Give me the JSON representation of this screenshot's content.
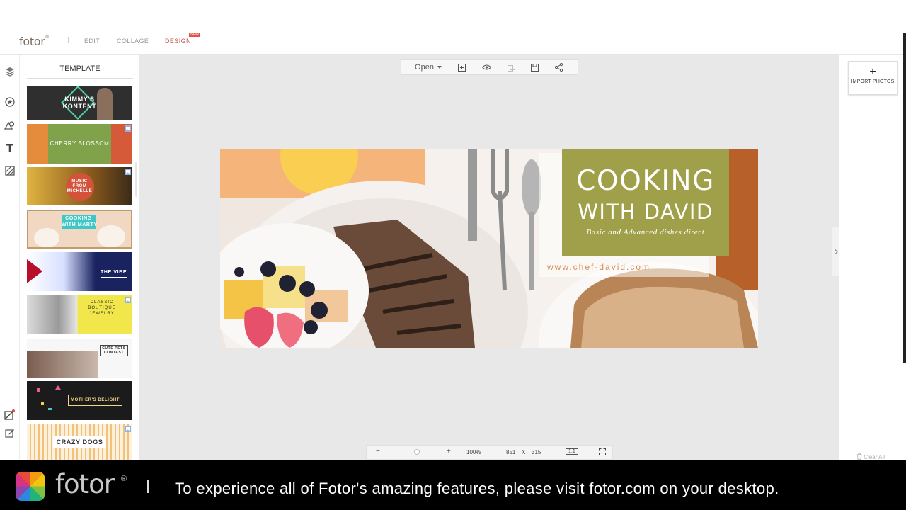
{
  "header": {
    "logo": "fotor",
    "logo_reg": "®",
    "nav": {
      "edit": "EDIT",
      "collage": "COLLAGE",
      "design": "DESIGN"
    },
    "design_badge": "NEW"
  },
  "rail": {
    "icons": [
      "layers-icon",
      "sticker-icon",
      "shapes-icon",
      "text-icon",
      "background-icon",
      "new-design-icon",
      "edit-icon"
    ]
  },
  "panel": {
    "title": "TEMPLATE",
    "templates": [
      {
        "title": "KIMMY'S\nKONTENT",
        "favorite": false,
        "bg": "#2f2f2f",
        "fg": "#ffffff"
      },
      {
        "title": "CHERRY BLOSSOM",
        "favorite": true,
        "bg": "#8a9a3c",
        "fg": "#ffffff"
      },
      {
        "title": "MUSIC\nFROM\nMICHELLE",
        "favorite": true,
        "bg": "#c9922e",
        "fg": "#ffffff"
      },
      {
        "title": "COOKING\nWITH MARTY",
        "favorite": false,
        "bg": "#e8c9b3",
        "fg": "#ffffff"
      },
      {
        "title": "THE VIBE",
        "favorite": false,
        "bg": "#1c2a6b",
        "fg": "#ffffff"
      },
      {
        "title": "CLASSIC\nBOUTIQUE\nJEWELRY",
        "favorite": true,
        "bg": "#f1e64a",
        "fg": "#333333"
      },
      {
        "title": "CUTE PETS\nCONTEST",
        "favorite": false,
        "bg": "#f3f3f3",
        "fg": "#333333"
      },
      {
        "title": "MOTHER'S DELIGHT",
        "favorite": false,
        "bg": "#1b1b1b",
        "fg": "#f0d68a"
      },
      {
        "title": "CRAZY DOGS",
        "favorite": true,
        "bg": "#fbf1dc",
        "fg": "#333333"
      }
    ]
  },
  "toolbar": {
    "open_label": "Open",
    "icons": [
      "add-page-icon",
      "preview-icon",
      "copy-icon",
      "save-icon",
      "share-icon"
    ]
  },
  "banner": {
    "title_line1": "COOKING",
    "title_line2": "WITH DAVID",
    "tagline": "Basic and Advanced dishes direct",
    "url": "www.chef-david.com",
    "accent": "#a0a04a",
    "url_color": "#d98a55"
  },
  "right_panel": {
    "import_label": "IMPORT PHOTOS",
    "clear_label": "Clear All"
  },
  "zoom": {
    "minus": "−",
    "plus": "+",
    "zoom_level": "100%",
    "width": "851",
    "times": "X",
    "height": "315",
    "actual_size": "1:1"
  },
  "footer": {
    "logo_text": "fotor",
    "reg": "®",
    "message": "To experience all of Fotor's amazing features, please visit fotor.com on your desktop."
  }
}
